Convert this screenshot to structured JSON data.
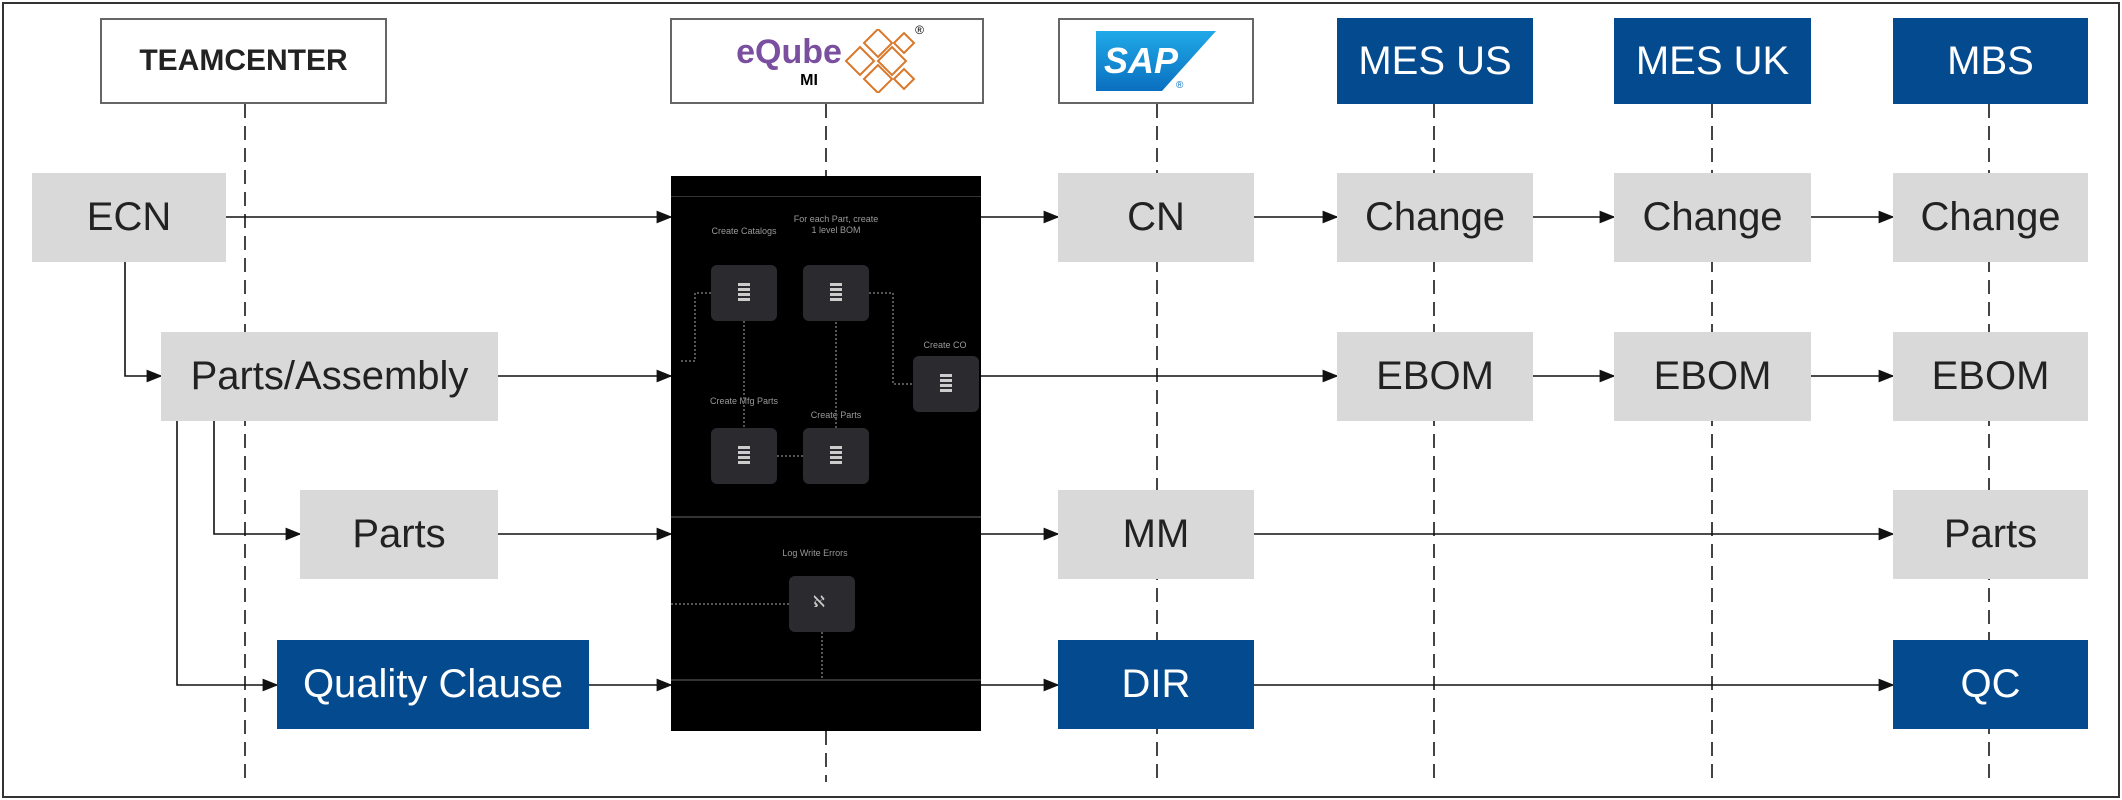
{
  "headers": {
    "teamcenter": "TEAMCENTER",
    "eqube": {
      "word": "eQube",
      "sub": "MI",
      "registered": "®"
    },
    "sap": {
      "word": "SAP",
      "registered": "®"
    },
    "mes_us": "MES US",
    "mes_uk": "MES UK",
    "mbs": "MBS"
  },
  "rows": {
    "ecn": "ECN",
    "parts_assembly": "Parts/Assembly",
    "parts": "Parts",
    "quality_clause": "Quality Clause",
    "cn": "CN",
    "change_us": "Change",
    "change_uk": "Change",
    "change_mbs": "Change",
    "ebom_us": "EBOM",
    "ebom_uk": "EBOM",
    "ebom_mbs": "EBOM",
    "mm": "MM",
    "parts_mbs": "Parts",
    "dir": "DIR",
    "qc": "QC"
  },
  "workflow": {
    "create_catalogs": "Create Catalogs",
    "for_each_part": "For each Part, create 1 level BOM",
    "create_co": "Create CO",
    "create_mfg_parts": "Create Mfg Parts",
    "create_parts": "Create Parts",
    "log_write_errors": "Log Write Errors"
  },
  "colors": {
    "blue": "#044a8f",
    "gray": "#d9d9d9",
    "sap_blue": "#1a8fd6",
    "eqube_orange": "#d9782a"
  }
}
